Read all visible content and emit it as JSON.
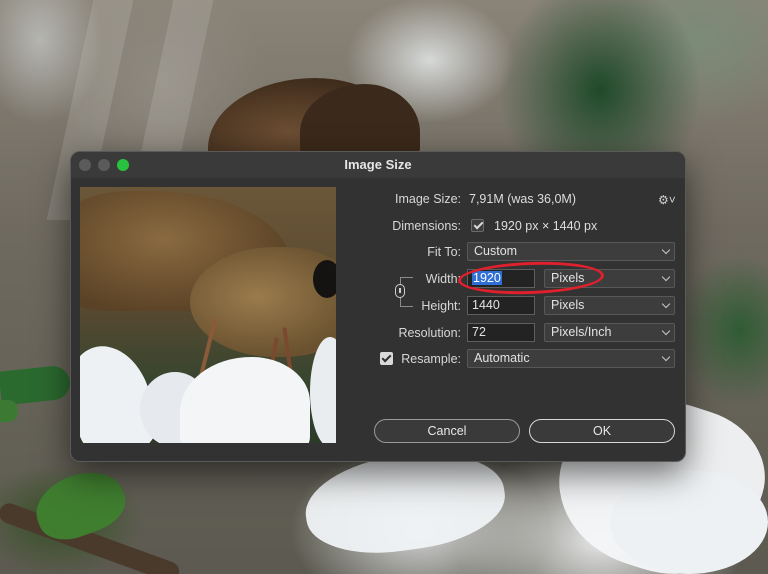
{
  "dialog": {
    "title": "Image Size",
    "image_size_label": "Image Size:",
    "image_size_value": "7,91M (was 36,0M)",
    "settings_icon": "gear-icon",
    "dimensions_label": "Dimensions:",
    "dimensions_value": "1920 px  ×  1440 px",
    "fit_to_label": "Fit To:",
    "fit_to_value": "Custom",
    "width_label": "Width:",
    "width_value": "1920",
    "width_unit": "Pixels",
    "height_label": "Height:",
    "height_value": "1440",
    "height_unit": "Pixels",
    "resolution_label": "Resolution:",
    "resolution_value": "72",
    "resolution_unit": "Pixels/Inch",
    "resample_label": "Resample:",
    "resample_value": "Automatic",
    "resample_checked": true,
    "cancel_label": "Cancel",
    "ok_label": "OK"
  },
  "annotation": {
    "color": "#e0202c"
  },
  "colors": {
    "dialog_bg": "#323232",
    "selection": "#2f6fd6",
    "zoom_button": "#29c23e"
  }
}
